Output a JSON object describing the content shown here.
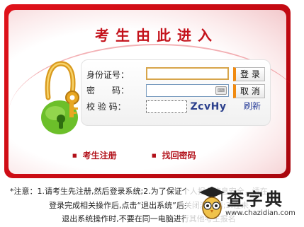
{
  "title": "考生由此进入",
  "form": {
    "id_label": "身份证号：",
    "password_label": "密　　码：",
    "captcha_label": "校 验 码：",
    "id_value": "",
    "password_value": "",
    "captcha_value": "",
    "captcha_text": "ZcvHy",
    "login_label": "登 录",
    "cancel_label": "取 消",
    "refresh_label": "刷新"
  },
  "links": {
    "register": "考生注册",
    "recover": "找回密码"
  },
  "notice": {
    "line1": "*注意：1.请考生先注册,然后登录系统;2.为了保证个人报名信息安全，请在",
    "line2": "登录完成相关操作后,点击“退出系统”后关闭浏览器;3.在未",
    "line3": "退出系统操作时,不要在同一电脑进行其他考生报名"
  },
  "watermark": {
    "brand": "查字典",
    "url": "www.chazidian.com"
  },
  "colors": {
    "frame_red": "#c40a12",
    "link_red": "#b21019",
    "button_accent": "#f08a10",
    "captcha_blue": "#2b3f8c"
  },
  "icons": {
    "lock": "lock-key-icon",
    "keyboard": "keyboard-icon",
    "watermark": "owl-graduate-icon"
  }
}
